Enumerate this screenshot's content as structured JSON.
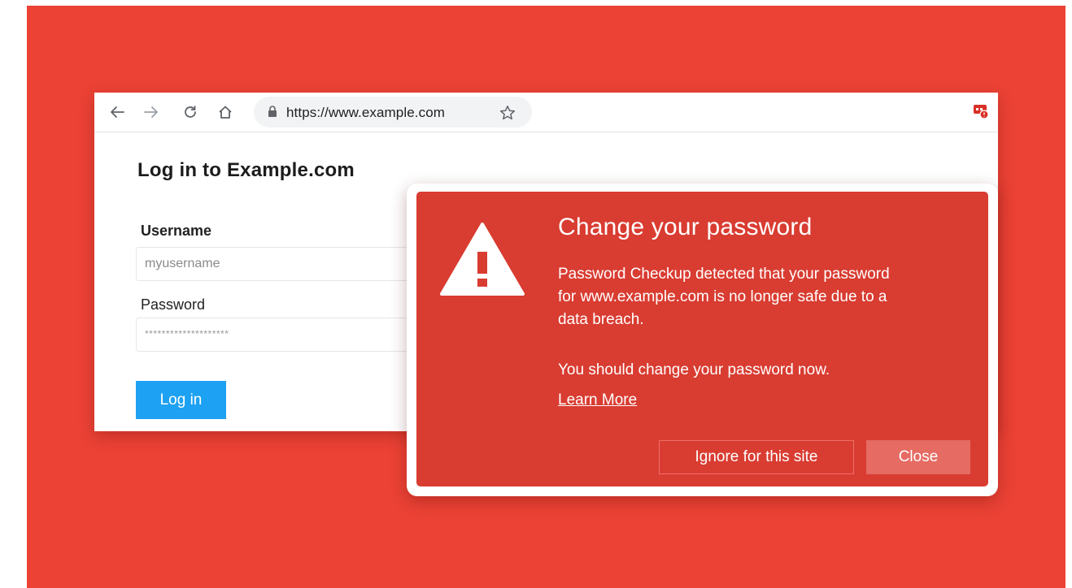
{
  "browser": {
    "url": "https://www.example.com",
    "icons": {
      "back": "back-arrow-icon",
      "forward": "forward-arrow-icon",
      "reload": "reload-icon",
      "home": "home-icon",
      "lock": "lock-icon",
      "bookmark": "star-icon",
      "extension": "password-checkup-extension-icon"
    }
  },
  "page": {
    "title": "Log in to Example.com",
    "username_label": "Username",
    "username_value": "myusername",
    "password_label": "Password",
    "password_value": "********************",
    "login_button": "Log in"
  },
  "alert": {
    "icon": "warning-triangle-icon",
    "title": "Change your password",
    "message": "Password Checkup detected that your password\nfor www.example.com is no longer safe due to a\ndata breach.",
    "advice": "You should change your password now.",
    "learn_more": "Learn More",
    "ignore_button": "Ignore for this site",
    "close_button": "Close"
  },
  "colors": {
    "background": "#eb4235",
    "alert": "#d93c31",
    "login_button": "#1da1f2"
  }
}
